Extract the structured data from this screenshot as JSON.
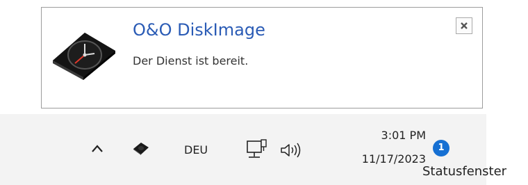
{
  "notification": {
    "title": "O&O DiskImage",
    "message": "Der Dienst ist bereit.",
    "close_icon": "close-icon"
  },
  "taskbar": {
    "overflow_icon": "chevron-up-icon",
    "app_icon": "diskimage-tray-icon",
    "language": "DEU",
    "network_icon": "network-icon",
    "volume_icon": "speaker-icon",
    "time": "3:01 PM",
    "date": "11/17/2023",
    "notification_count": "1"
  },
  "caption": "Statusfenster",
  "colors": {
    "title": "#2a5bb5",
    "badge": "#1670d3",
    "taskbar_bg": "#f3f3f3"
  }
}
